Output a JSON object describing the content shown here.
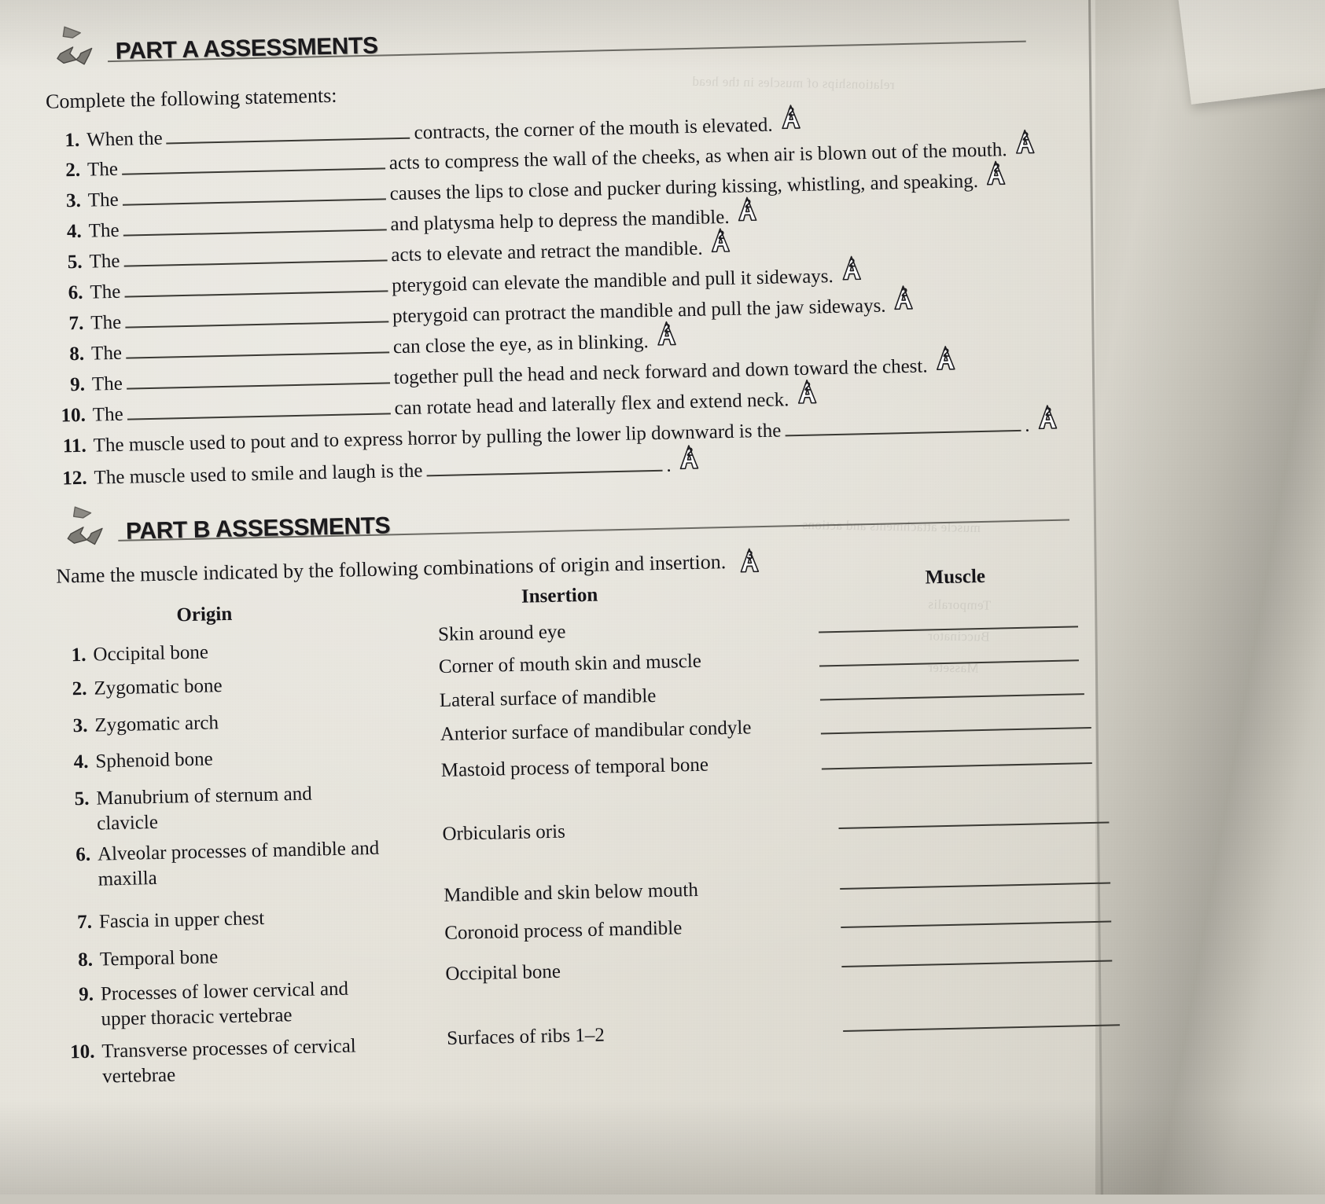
{
  "part_a": {
    "title": "PART A ASSESSMENTS",
    "icon": "recycle-arrows-icon",
    "lead": "Complete the following statements:",
    "statements": [
      {
        "num": "1.",
        "before": "When the",
        "after": "contracts, the corner of the mouth is elevated.",
        "outcome": "2"
      },
      {
        "num": "2.",
        "before": "The",
        "after": "acts to compress the wall of the cheeks, as when air is blown out of the mouth.",
        "outcome": "2"
      },
      {
        "num": "3.",
        "before": "The",
        "after": "causes the lips to close and pucker during kissing, whistling, and speaking.",
        "outcome": "2"
      },
      {
        "num": "4.",
        "before": "The",
        "after": "and platysma help to depress the mandible.",
        "outcome": "2"
      },
      {
        "num": "5.",
        "before": "The",
        "after": "acts to elevate and retract the mandible.",
        "outcome": "2"
      },
      {
        "num": "6.",
        "before": "The",
        "after": "pterygoid can elevate the mandible and pull it sideways.",
        "outcome": "2"
      },
      {
        "num": "7.",
        "before": "The",
        "after": "pterygoid can protract the mandible and pull the jaw sideways.",
        "outcome": "2"
      },
      {
        "num": "8.",
        "before": "The",
        "after": "can close the eye, as in blinking.",
        "outcome": "2"
      },
      {
        "num": "9.",
        "before": "The",
        "after": "together pull the head and neck forward and down toward the chest.",
        "outcome": "2"
      },
      {
        "num": "10.",
        "before": "The",
        "after": "can rotate head and laterally flex and extend neck.",
        "outcome": "2"
      },
      {
        "num": "11.",
        "before": "The muscle used to pout and to express horror by pulling the lower lip downward is the",
        "after": ".",
        "outcome": "2"
      },
      {
        "num": "12.",
        "before": "The muscle used to smile and laugh is the",
        "after": ".",
        "outcome": "2"
      }
    ]
  },
  "part_b": {
    "title": "PART B ASSESSMENTS",
    "icon": "recycle-arrows-icon",
    "lead": "Name the muscle indicated by the following combinations of origin and insertion.",
    "lead_outcome": "3",
    "columns": {
      "origin": "Origin",
      "insertion": "Insertion",
      "muscle": "Muscle"
    },
    "origins": [
      {
        "num": "1.",
        "text": "Occipital bone"
      },
      {
        "num": "2.",
        "text": "Zygomatic bone"
      },
      {
        "num": "3.",
        "text": "Zygomatic arch"
      },
      {
        "num": "4.",
        "text": "Sphenoid bone"
      },
      {
        "num": "5.",
        "text": "Manubrium of sternum and clavicle"
      },
      {
        "num": "6.",
        "text": "Alveolar processes of mandible and maxilla"
      },
      {
        "num": "7.",
        "text": "Fascia in upper chest"
      },
      {
        "num": "8.",
        "text": "Temporal bone"
      },
      {
        "num": "9.",
        "text": "Processes of lower cervical and upper thoracic vertebrae"
      },
      {
        "num": "10.",
        "text": "Transverse processes of cervical vertebrae"
      }
    ],
    "insertions": [
      "Skin around eye",
      "Corner of mouth skin and muscle",
      "Lateral surface of mandible",
      "Anterior surface of mandibular condyle",
      "Mastoid process of temporal bone",
      "Orbicularis oris",
      "Mandible and skin below mouth",
      "Coronoid process of mandible",
      "Occipital bone",
      "Surfaces of ribs 1–2"
    ],
    "muscle_answers": [
      "",
      "",
      "",
      "",
      "",
      "",
      "",
      "",
      "",
      ""
    ]
  },
  "colors": {
    "paper": "#e7e4db",
    "ink": "#17161a",
    "rule": "#3a3934"
  }
}
